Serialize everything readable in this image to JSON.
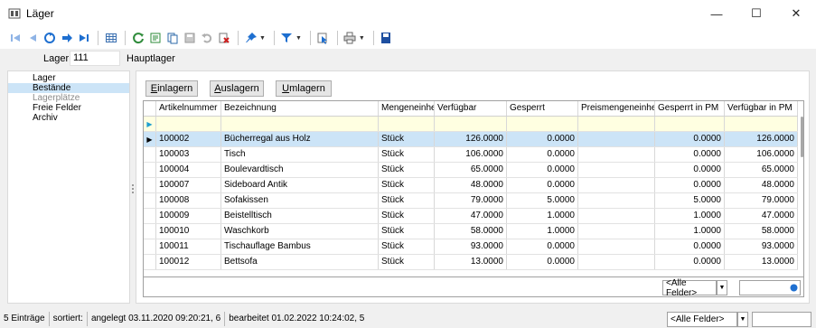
{
  "window": {
    "title": "Läger",
    "minimize": "—",
    "maximize": "☐",
    "close": "✕"
  },
  "toolbar": {
    "icons": [
      "first-icon",
      "prev-icon",
      "refresh-circle-icon",
      "next-icon",
      "last-icon",
      "table-icon",
      "reload-icon",
      "export-icon",
      "copy-icon",
      "save-icon",
      "undo-icon",
      "delete-icon",
      "pin-icon",
      "filter-icon",
      "pointer-icon",
      "print-icon",
      "disk-icon"
    ]
  },
  "lager": {
    "label": "Lager",
    "value": "111",
    "description": "Hauptlager"
  },
  "sidenav": {
    "items": [
      {
        "label": "Lager",
        "state": "normal"
      },
      {
        "label": "Bestände",
        "state": "selected"
      },
      {
        "label": "Lagerplätze",
        "state": "disabled"
      },
      {
        "label": "Freie Felder",
        "state": "normal"
      },
      {
        "label": "Archiv",
        "state": "normal"
      }
    ]
  },
  "actions": {
    "einlagern": {
      "pre": "",
      "u": "E",
      "post": "inlagern"
    },
    "auslagern": {
      "pre": "",
      "u": "A",
      "post": "uslagern"
    },
    "umlagern": {
      "pre": "",
      "u": "U",
      "post": "mlagern"
    }
  },
  "grid": {
    "columns": [
      "Artikelnummer",
      "Bezeichnung",
      "Mengeneinheit",
      "Verfügbar",
      "Gesperrt",
      "Preismengeneinheit",
      "Gesperrt in PM",
      "Verfügbar in PM"
    ],
    "rows": [
      {
        "artikelnummer": "100002",
        "bezeichnung": "Bücherregal aus Holz",
        "mengeneinheit": "Stück",
        "verfuegbar": "126.0000",
        "gesperrt": "0.0000",
        "preismengeneinheit": "",
        "gesperrt_pm": "0.0000",
        "verfuegbar_pm": "126.0000",
        "selected": true
      },
      {
        "artikelnummer": "100003",
        "bezeichnung": "Tisch",
        "mengeneinheit": "Stück",
        "verfuegbar": "106.0000",
        "gesperrt": "0.0000",
        "preismengeneinheit": "",
        "gesperrt_pm": "0.0000",
        "verfuegbar_pm": "106.0000"
      },
      {
        "artikelnummer": "100004",
        "bezeichnung": "Boulevardtisch",
        "mengeneinheit": "Stück",
        "verfuegbar": "65.0000",
        "gesperrt": "0.0000",
        "preismengeneinheit": "",
        "gesperrt_pm": "0.0000",
        "verfuegbar_pm": "65.0000"
      },
      {
        "artikelnummer": "100007",
        "bezeichnung": "Sideboard Antik",
        "mengeneinheit": "Stück",
        "verfuegbar": "48.0000",
        "gesperrt": "0.0000",
        "preismengeneinheit": "",
        "gesperrt_pm": "0.0000",
        "verfuegbar_pm": "48.0000"
      },
      {
        "artikelnummer": "100008",
        "bezeichnung": "Sofakissen",
        "mengeneinheit": "Stück",
        "verfuegbar": "79.0000",
        "gesperrt": "5.0000",
        "preismengeneinheit": "",
        "gesperrt_pm": "5.0000",
        "verfuegbar_pm": "79.0000"
      },
      {
        "artikelnummer": "100009",
        "bezeichnung": "Beistelltisch",
        "mengeneinheit": "Stück",
        "verfuegbar": "47.0000",
        "gesperrt": "1.0000",
        "preismengeneinheit": "",
        "gesperrt_pm": "1.0000",
        "verfuegbar_pm": "47.0000"
      },
      {
        "artikelnummer": "100010",
        "bezeichnung": "Waschkorb",
        "mengeneinheit": "Stück",
        "verfuegbar": "58.0000",
        "gesperrt": "1.0000",
        "preismengeneinheit": "",
        "gesperrt_pm": "1.0000",
        "verfuegbar_pm": "58.0000"
      },
      {
        "artikelnummer": "100011",
        "bezeichnung": "Tischauflage Bambus",
        "mengeneinheit": "Stück",
        "verfuegbar": "93.0000",
        "gesperrt": "0.0000",
        "preismengeneinheit": "",
        "gesperrt_pm": "0.0000",
        "verfuegbar_pm": "93.0000"
      },
      {
        "artikelnummer": "100012",
        "bezeichnung": "Bettsofa",
        "mengeneinheit": "Stück",
        "verfuegbar": "13.0000",
        "gesperrt": "0.0000",
        "preismengeneinheit": "",
        "gesperrt_pm": "0.0000",
        "verfuegbar_pm": "13.0000"
      }
    ],
    "field_filter": "<Alle Felder>"
  },
  "statusbar": {
    "count": "5 Einträge",
    "sorted": "sortiert:",
    "created": "angelegt 03.11.2020 09:20:21, 6",
    "edited": "bearbeitet 01.02.2022 10:24:02, 5",
    "field_filter": "<Alle Felder>"
  },
  "colors": {
    "selection": "#cce4f7",
    "filter_row": "#ffffe1",
    "accent_blue": "#1e6fd0"
  }
}
